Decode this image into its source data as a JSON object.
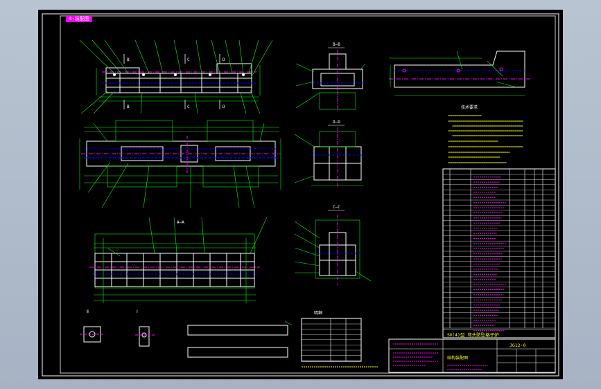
{
  "drawing": {
    "tag": "4-装配图",
    "colors": {
      "background": "#000000",
      "frame": "#ffffff",
      "outline": "#ffffff",
      "dimension": "#00ff00",
      "centerline": "#ff00ff",
      "hidden": "#0000ff",
      "title_text": "#ffff00"
    },
    "view_labels": {
      "b_b": "B—B",
      "d_d": "D—D",
      "c_c": "C—C",
      "a_a": "A—A",
      "detail_ii": "Ⅱ",
      "detail_i": "Ⅰ"
    },
    "section_letters": {
      "b": "B",
      "c": "C",
      "d": "D"
    },
    "notes_heading": "技术要求",
    "table_heading": "明细",
    "title_block": {
      "project": "SⅡ(4)型 弯头防坠格子炉",
      "drawing_no": "JG12-0",
      "part_name": "结构装配图"
    }
  }
}
